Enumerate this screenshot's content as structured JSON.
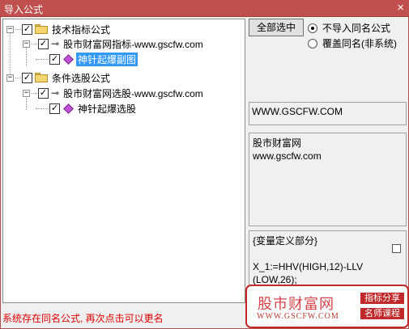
{
  "window": {
    "title": "导入公式",
    "close_glyph": "×"
  },
  "tree": {
    "nodes": [
      {
        "label": "技术指标公式"
      },
      {
        "label": "股市财富网指标-www.gscfw.com"
      },
      {
        "label": "神针起爆副图"
      },
      {
        "label": "条件选股公式"
      },
      {
        "label": "股市财富网选股-www.gscfw.com"
      },
      {
        "label": "神针起爆选股"
      }
    ]
  },
  "options": {
    "select_all_label": "全部选中",
    "radio_skip_label": "不导入同名公式",
    "radio_overwrite_label": "覆盖同名(非系统)",
    "selected_radio": "skip"
  },
  "info": {
    "website": "WWW.GSCFW.COM",
    "desc_line1": "股市财富网",
    "desc_line2": "www.gscfw.com",
    "code_line1": "{变量定义部分}",
    "code_line2": "X_1:=HHV(HIGH,12)-LLV",
    "code_line3": "(LOW,26);"
  },
  "status": {
    "message": "系统存在同名公式, 再次点击可以更名"
  },
  "watermark": {
    "brand": "股市财富网",
    "url": "WWW.GSCFW.COM",
    "tag1": "指标分享",
    "tag2": "名师课程"
  },
  "colors": {
    "titlebar": "#c0504d",
    "selection": "#3399ff",
    "status_text": "#e00000",
    "watermark_border": "#c0282a"
  }
}
